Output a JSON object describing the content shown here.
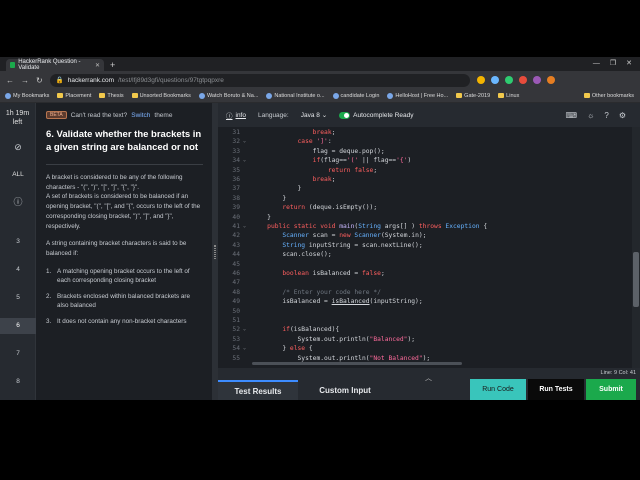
{
  "browser": {
    "tab_title": "HackerRank Question - Validate",
    "url_host": "hackerrank.com",
    "url_path": "/test/lfj89d3gfi/questions/97tgtpqpxre",
    "new_tab": "+",
    "bookmarks": [
      "My Bookmarks",
      "Placement",
      "Thesis",
      "Unsorted Bookmarks",
      "Watch Boruto & Na...",
      "National Institute o...",
      "candidate Login",
      "HelloHost | Free Ho...",
      "Gate-2019",
      "Linux",
      "Other bookmarks"
    ]
  },
  "rail": {
    "timer_line1": "1h 19m",
    "timer_line2": "left",
    "all_label": "ALL",
    "numbers": [
      "3",
      "4",
      "5",
      "6",
      "7",
      "8"
    ],
    "active": "6"
  },
  "question": {
    "beta": "BETA",
    "notice_text": "Can't read the text?",
    "notice_link": "Switch",
    "notice_tail": "theme",
    "title": "6. Validate whether the brackets in a given string are balanced or not",
    "para1": "A bracket is considered to be any of the following characters - \"(\", \")\", \"[\", \"]\", \"{\", \"}\".",
    "para2": "A set of brackets is considered to be balanced if an opening bracket, \"(\", \"[\", and \"{\", occurs to the left of the corresponding closing bracket, \")\", \"]\", and \"}\", respectively.",
    "para3": "A string containing bracket characters is said to be balanced if:",
    "rules": [
      {
        "n": "1.",
        "text": "A matching opening bracket occurs to the left of each corresponding closing bracket"
      },
      {
        "n": "2.",
        "text": "Brackets enclosed within balanced brackets are also balanced"
      },
      {
        "n": "3.",
        "text": "It does not contain any non-bracket characters"
      }
    ]
  },
  "editor": {
    "info": "info",
    "language_label": "Language:",
    "language": "Java 8",
    "autocomplete": "Autocomplete Ready",
    "status": "Line: 9 Col: 41",
    "lines": [
      {
        "n": "31",
        "fold": "",
        "html": "                <span class='kw'>break</span>;"
      },
      {
        "n": "32",
        "fold": "⌄",
        "html": "            <span class='kw'>case</span> <span class='st'>']'</span>:"
      },
      {
        "n": "33",
        "fold": "",
        "html": "                flag = deque.pop();"
      },
      {
        "n": "34",
        "fold": "⌄",
        "html": "                <span class='kw'>if</span>(flag==<span class='st'>'('</span> || flag==<span class='st'>'{'</span>)"
      },
      {
        "n": "35",
        "fold": "",
        "html": "                    <span class='kw'>return</span> <span class='kw'>false</span>;"
      },
      {
        "n": "36",
        "fold": "",
        "html": "                <span class='kw'>break</span>;"
      },
      {
        "n": "37",
        "fold": "",
        "html": "            }"
      },
      {
        "n": "38",
        "fold": "",
        "html": "        }"
      },
      {
        "n": "39",
        "fold": "",
        "html": "        <span class='kw'>return</span> (deque.isEmpty());"
      },
      {
        "n": "40",
        "fold": "",
        "html": "    }"
      },
      {
        "n": "41",
        "fold": "⌄",
        "html": "    <span class='kw'>public static void</span> <span class='fn'>main</span>(<span class='ty'>String</span> args[] ) <span class='kw'>throws</span> <span class='ty'>Exception</span> {"
      },
      {
        "n": "42",
        "fold": "",
        "html": "        <span class='ty'>Scanner</span> scan = <span class='kw'>new</span> <span class='ty'>Scanner</span>(System.in);"
      },
      {
        "n": "43",
        "fold": "",
        "html": "        <span class='ty'>String</span> inputString = scan.nextLine();"
      },
      {
        "n": "44",
        "fold": "",
        "html": "        scan.close();"
      },
      {
        "n": "45",
        "fold": "",
        "html": ""
      },
      {
        "n": "46",
        "fold": "",
        "html": "        <span class='kw'>boolean</span> isBalanced = <span class='kw'>false</span>;"
      },
      {
        "n": "47",
        "fold": "",
        "html": ""
      },
      {
        "n": "48",
        "fold": "",
        "html": "        <span class='cm'>/* Enter your code here */</span>"
      },
      {
        "n": "49",
        "fold": "",
        "html": "        isBalanced = <span style='text-decoration:underline'>isBalanced</span>(inputString);"
      },
      {
        "n": "50",
        "fold": "",
        "html": ""
      },
      {
        "n": "51",
        "fold": "",
        "html": ""
      },
      {
        "n": "52",
        "fold": "⌄",
        "html": "        <span class='kw'>if</span>(isBalanced){"
      },
      {
        "n": "53",
        "fold": "",
        "html": "            System.out.println(<span class='st'>\"Balanced\"</span>);"
      },
      {
        "n": "54",
        "fold": "⌄",
        "html": "        } <span class='kw'>else</span> {"
      },
      {
        "n": "55",
        "fold": "",
        "html": "            System.out.println(<span class='st'>\"Not Balanced\"</span>);"
      }
    ]
  },
  "bottom": {
    "test_results": "Test Results",
    "custom_input": "Custom Input",
    "run_code": "Run Code",
    "run_tests": "Run Tests",
    "submit": "Submit"
  }
}
